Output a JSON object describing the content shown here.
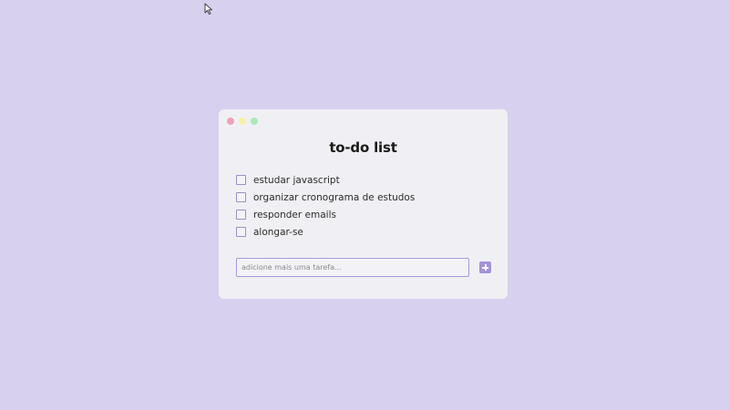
{
  "app": {
    "title": "to-do list"
  },
  "window_controls": [
    {
      "name": "close",
      "color": "#f2a0b8"
    },
    {
      "name": "minimize",
      "color": "#f7f0a8"
    },
    {
      "name": "maximize",
      "color": "#a8eab8"
    }
  ],
  "tasks": [
    {
      "label": "estudar javascript",
      "checked": false
    },
    {
      "label": "organizar cronograma de estudos",
      "checked": false
    },
    {
      "label": "responder emails",
      "checked": false
    },
    {
      "label": "alongar-se",
      "checked": false
    }
  ],
  "new_task": {
    "placeholder": "adicione mais uma tarefa...",
    "value": "",
    "add_icon": "plus-square-icon"
  },
  "colors": {
    "background": "#d8d0ef",
    "card": "#f0f0f4",
    "accent": "#a493d8"
  }
}
